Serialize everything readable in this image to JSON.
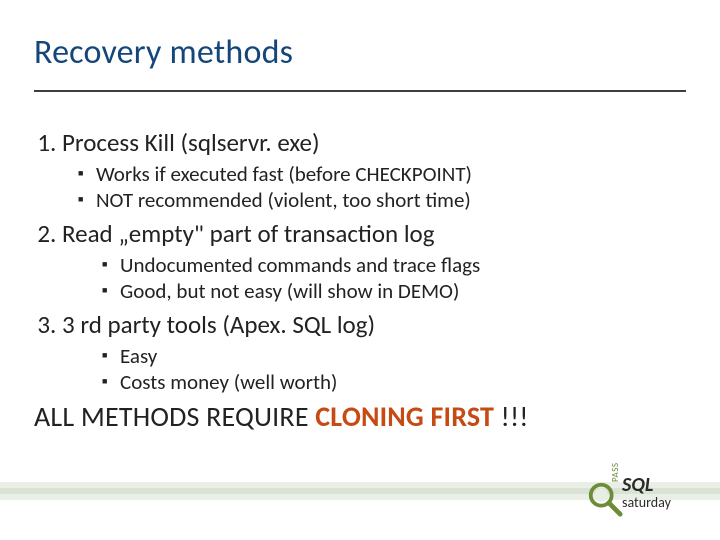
{
  "title": "Recovery methods",
  "items": [
    {
      "head": "Process Kill (sqlservr. exe)",
      "sub": [
        "Works if executed fast (before CHECKPOINT)",
        "NOT recommended (violent, too short time)"
      ]
    },
    {
      "head": "Read „empty\" part of transaction log",
      "sub": [
        "Undocumented commands and trace flags",
        "Good, but not easy (will show in DEMO)"
      ]
    },
    {
      "head": "3 rd party tools (Apex. SQL log)",
      "sub": [
        "Easy",
        "Costs money (well worth)"
      ]
    }
  ],
  "final_prefix": "ALL METHODS REQUIRE ",
  "final_em": "CLONING FIRST",
  "final_suffix": " !!!",
  "logo": {
    "big": "SQL",
    "small": "saturday",
    "side": "PASS"
  }
}
